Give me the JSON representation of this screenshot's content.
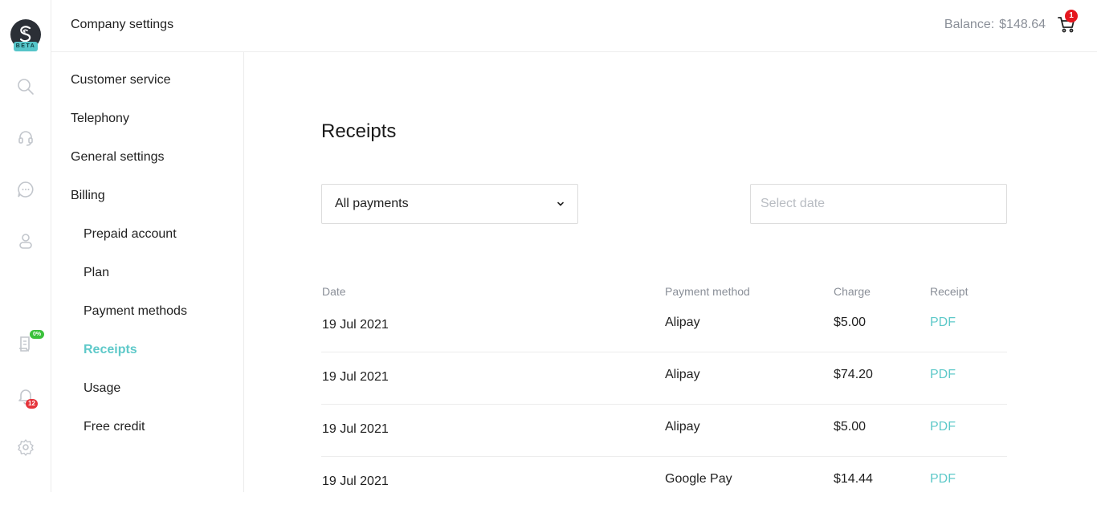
{
  "brand": {
    "badge": "BETA"
  },
  "rail": {
    "icons": [
      "search-icon",
      "headset-icon",
      "chat-icon",
      "user-icon",
      "document-icon",
      "bell-icon",
      "gear-icon"
    ],
    "document_badge": "0%",
    "bell_badge": "12"
  },
  "header": {
    "title": "Company settings",
    "balance_label": "Balance:",
    "balance_value": "$148.64",
    "cart_count": "1"
  },
  "subnav": {
    "customer_service": "Customer service",
    "telephony": "Telephony",
    "general_settings": "General settings",
    "billing": "Billing",
    "prepaid_account": "Prepaid account",
    "plan": "Plan",
    "payment_methods": "Payment methods",
    "receipts": "Receipts",
    "usage": "Usage",
    "free_credit": "Free credit"
  },
  "main": {
    "title": "Receipts",
    "filter_selected": "All payments",
    "date_placeholder": "Select date",
    "columns": {
      "date": "Date",
      "method": "Payment method",
      "charge": "Charge",
      "receipt": "Receipt"
    },
    "rows": [
      {
        "date": "19 Jul 2021",
        "method": "Alipay",
        "charge": "$5.00",
        "receipt": "PDF"
      },
      {
        "date": "19 Jul 2021",
        "method": "Alipay",
        "charge": "$74.20",
        "receipt": "PDF"
      },
      {
        "date": "19 Jul 2021",
        "method": "Alipay",
        "charge": "$5.00",
        "receipt": "PDF"
      },
      {
        "date": "19 Jul 2021",
        "method": "Google Pay",
        "charge": "$14.44",
        "receipt": "PDF"
      }
    ]
  },
  "colors": {
    "accent": "#5ec9c9",
    "alert": "#e5343b",
    "success": "#3bc13b"
  }
}
